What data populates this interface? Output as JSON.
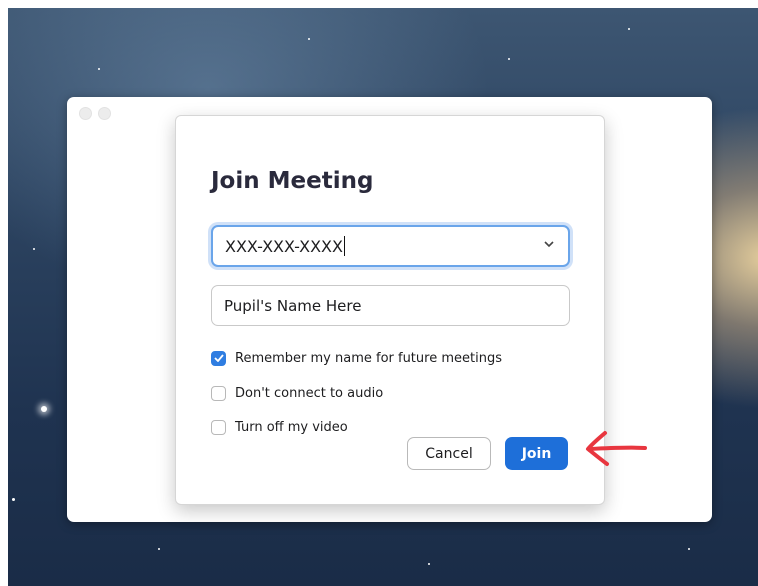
{
  "dialog": {
    "title": "Join Meeting",
    "meeting_id": {
      "value": "XXX-XXX-XXXX",
      "dropdown_icon": "chevron-down-icon"
    },
    "name_field": {
      "value": "Pupil's Name Here"
    },
    "options": [
      {
        "label": "Remember my name for future meetings",
        "checked": true
      },
      {
        "label": "Don't connect to audio",
        "checked": false
      },
      {
        "label": "Turn off my video",
        "checked": false
      }
    ],
    "buttons": {
      "cancel_label": "Cancel",
      "join_label": "Join"
    }
  },
  "annotation": {
    "icon": "hand-drawn-arrow-icon",
    "color": "#e8363f"
  },
  "colors": {
    "accent": "#1e6fd9",
    "focus_ring": "#6aa5ea",
    "checkbox_checked": "#2f7de1"
  }
}
